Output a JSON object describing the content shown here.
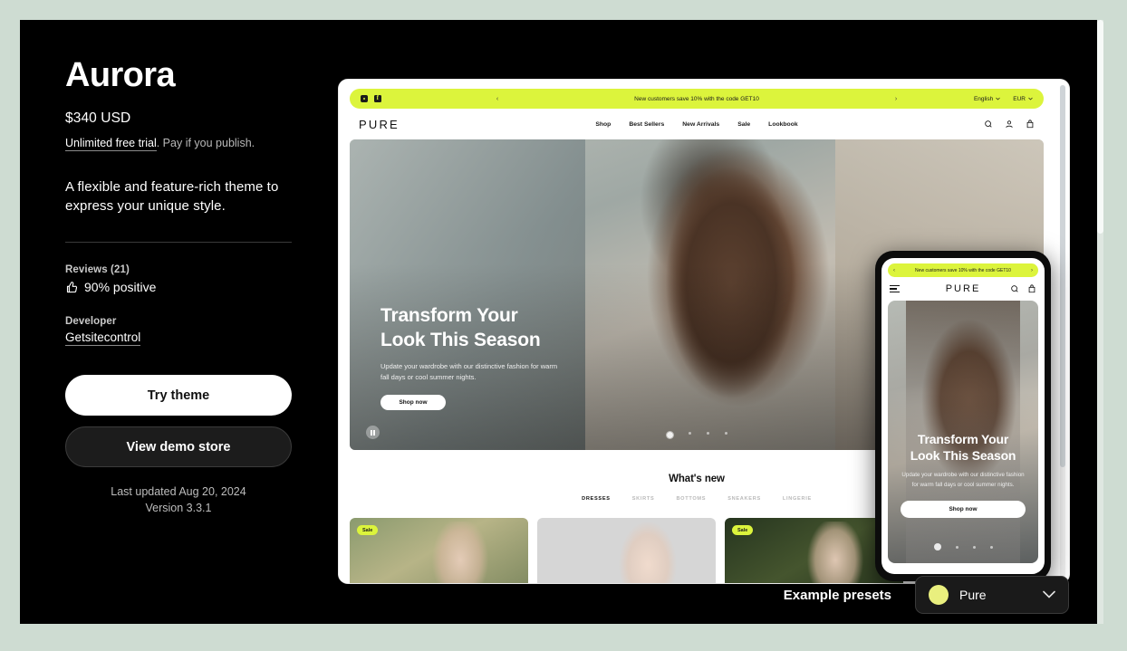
{
  "theme": {
    "title": "Aurora",
    "price": "$340 USD",
    "trial_link": "Unlimited free trial",
    "trial_rest": ". Pay if you publish.",
    "tagline": "A flexible and feature-rich theme to express your unique style.",
    "reviews_label": "Reviews (21)",
    "rating": "90% positive",
    "developer_label": "Developer",
    "developer_name": "Getsitecontrol",
    "try_button": "Try theme",
    "demo_button": "View demo store",
    "last_updated": "Last updated Aug 20, 2024",
    "version": "Version 3.3.1"
  },
  "presets": {
    "label": "Example presets",
    "selected": "Pure",
    "swatch_color": "#e9ef7e"
  },
  "preview": {
    "announcement": "New customers save 10% with the code GET10",
    "prev_arrow": "‹",
    "next_arrow": "›",
    "language": "English",
    "currency": "EUR",
    "brand": "PURE",
    "nav": [
      "Shop",
      "Best Sellers",
      "New Arrivals",
      "Sale",
      "Lookbook"
    ],
    "hero": {
      "heading_line1": "Transform Your",
      "heading_line2": "Look This Season",
      "paragraph": "Update your wardrobe with our distinctive fashion for warm fall days or cool summer nights.",
      "cta": "Shop now"
    },
    "whats_new": {
      "title": "What's new",
      "tabs": [
        "DRESSES",
        "SKIRTS",
        "BOTTOMS",
        "SNEAKERS",
        "LINGERIE"
      ]
    },
    "products": [
      {
        "badge": "Sale"
      },
      {
        "badge": ""
      },
      {
        "badge": "Sale"
      }
    ]
  },
  "mobile": {
    "announcement": "New customers save 10% with the code GET10",
    "brand": "PURE",
    "hero": {
      "heading_line1": "Transform Your",
      "heading_line2": "Look This Season",
      "paragraph": "Update your wardrobe with our distinctive fashion for warm fall days or cool summer nights.",
      "cta": "Shop now"
    }
  },
  "colors": {
    "page_background": "#cedcd2",
    "card_background": "#000000",
    "accent_lime": "#dcf43c"
  }
}
